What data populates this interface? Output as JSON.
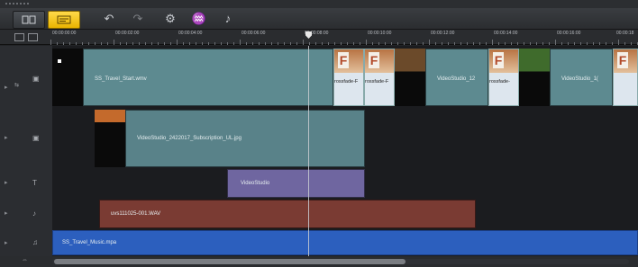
{
  "toolbar": {
    "buttons": [
      {
        "name": "undo",
        "glyph": "↶"
      },
      {
        "name": "redo",
        "glyph": "↷"
      },
      {
        "name": "record-capture",
        "glyph": "⚙"
      },
      {
        "name": "sound-mixer",
        "glyph": "♒"
      },
      {
        "name": "auto-music",
        "glyph": "♪"
      }
    ]
  },
  "ruler": {
    "labels": [
      "00:00:00:00",
      "00:00:02:00",
      "00:00:04:00",
      "00:00:06:00",
      "00:00:08:00",
      "00:00:10:00",
      "00:00:12:00",
      "00:00:14:00",
      "00:00:16:00",
      "00:00:18"
    ]
  },
  "tracks": {
    "video": {
      "main_clip": "SS_Travel_Start.wmv",
      "transition_1": "rossfade-F",
      "transition_2": "rossfade-F",
      "clip_2": "VideoStudio_12",
      "transition_3": "rossfade-",
      "clip_3": "VideoStudio_1("
    },
    "overlay": {
      "clip": "VideoStudio_2422017_Subscription_UL.jpg"
    },
    "title": {
      "clip": "VideoStudio"
    },
    "voice": {
      "clip": "uvs111025-001.WAV"
    },
    "music": {
      "clip": "SS_Travel_Music.mpa"
    }
  },
  "colors": {
    "video_clip": "#5d8a90",
    "overlay_clip": "#598289",
    "title_clip": "#6f66a0",
    "voice_clip": "#7a3b33",
    "music_clip": "#2c5fbe",
    "active_view": "#f2c420"
  }
}
